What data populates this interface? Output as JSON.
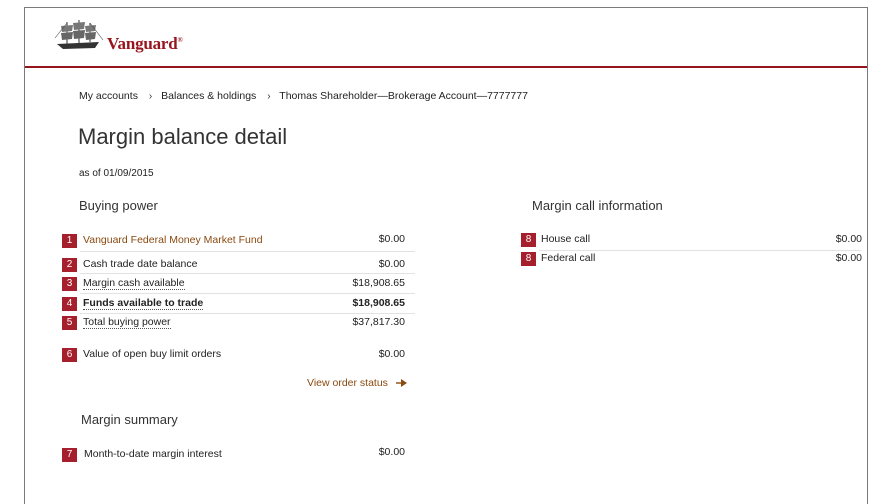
{
  "brand": {
    "name": "Vanguard",
    "trademark": "®"
  },
  "breadcrumb": [
    {
      "label": "My accounts"
    },
    {
      "label": "Balances & holdings"
    },
    {
      "label": "Thomas Shareholder—Brokerage Account—7777777"
    }
  ],
  "page": {
    "title": "Margin balance detail",
    "as_of": "as of 01/09/2015"
  },
  "buying_power": {
    "heading": "Buying power",
    "rows": [
      {
        "badge": "1",
        "label": "Vanguard Federal Money Market Fund",
        "value": "$0.00"
      },
      {
        "badge": "2",
        "label": "Cash trade date balance",
        "value": "$0.00"
      },
      {
        "badge": "3",
        "label": "Margin cash available",
        "value": "$18,908.65"
      },
      {
        "badge": "4",
        "label": "Funds available to trade",
        "value": "$18,908.65"
      },
      {
        "badge": "5",
        "label": "Total buying power",
        "value": "$37,817.30"
      },
      {
        "badge": "6",
        "label": "Value of open buy limit orders",
        "value": "$0.00"
      }
    ],
    "view_order_status": "View order status"
  },
  "margin_summary": {
    "heading": "Margin summary",
    "rows": [
      {
        "badge": "7",
        "label": "Month-to-date margin interest",
        "value": "$0.00"
      }
    ]
  },
  "margin_call": {
    "heading": "Margin call information",
    "rows": [
      {
        "badge": "8",
        "label": "House call",
        "value": "$0.00"
      },
      {
        "badge": "8",
        "label": "Federal call",
        "value": "$0.00"
      }
    ]
  },
  "colors": {
    "brand": "#96151d",
    "badge": "#a5202c",
    "link": "#8a4a10"
  },
  "icons": {
    "logo": "ship-logo-icon",
    "breadcrumb_sep": "chevron-right-icon",
    "link_arrow": "arrow-right-icon"
  }
}
